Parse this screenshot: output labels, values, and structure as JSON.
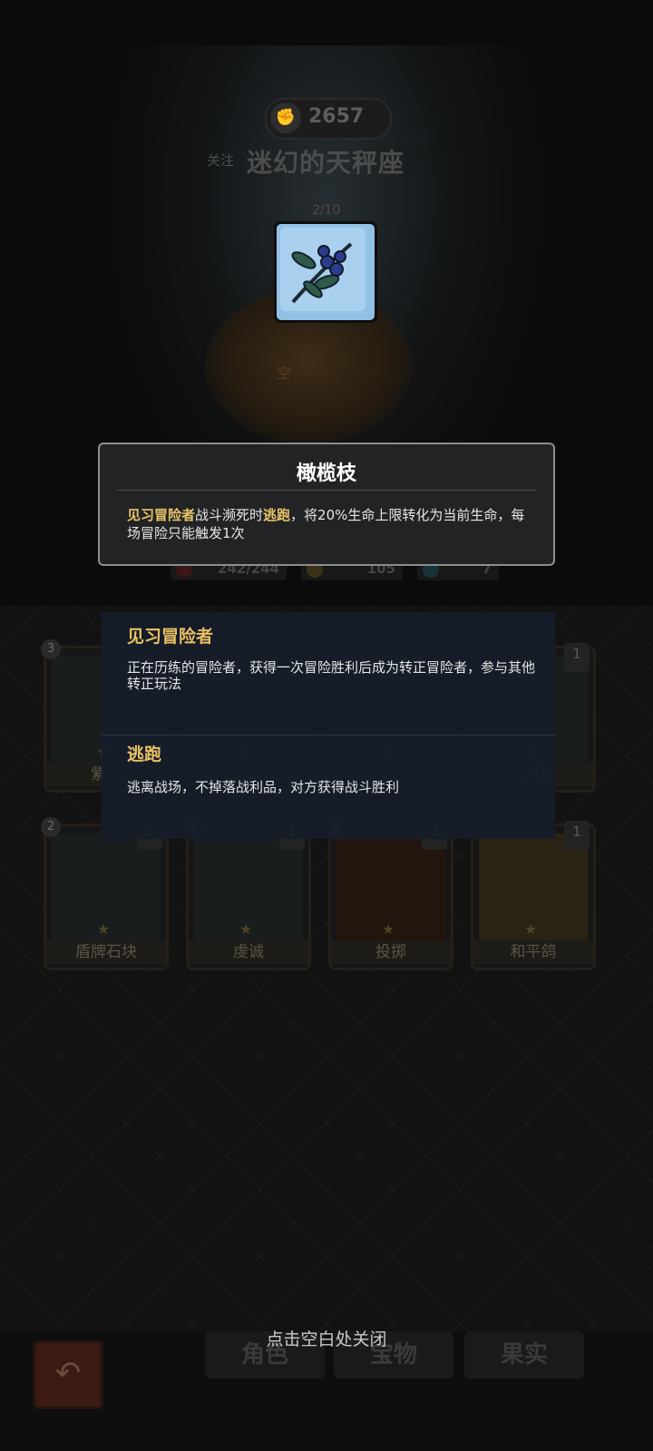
{
  "opponent": {
    "score": "2657",
    "follow_label": "关注",
    "name": "迷幻的天秤座",
    "counter": "2/10",
    "hero_tag": "空"
  },
  "stats": {
    "hp": "242/244",
    "attack": "105",
    "third": "7"
  },
  "tooltip": {
    "title": "橄榄枝",
    "desc_kw1": "见习冒险者",
    "desc_mid1": "战斗濒死时",
    "desc_kw2": "逃跑",
    "desc_rest": "，将20%生命上限转化为当前生命，每场冒险只能触发1次"
  },
  "keywords": [
    {
      "title": "见习冒险者",
      "text": "正在历练的冒险者，获得一次冒险胜利后成为转正冒险者，参与其他转正玩法"
    },
    {
      "title": "逃跑",
      "text": "逃离战场，不掉落战利品，对方获得战斗胜利"
    }
  ],
  "cards_row1": [
    {
      "name": "紫…",
      "level": "3",
      "stack": ""
    },
    {
      "name": "…",
      "level": "",
      "stack": ""
    },
    {
      "name": "…",
      "level": "",
      "stack": ""
    },
    {
      "name": "…灯",
      "level": "",
      "stack": "1"
    }
  ],
  "cards_row2": [
    {
      "name": "盾牌石块",
      "level": "2",
      "stack": "2"
    },
    {
      "name": "虔诚",
      "level": "2",
      "stack": "1"
    },
    {
      "name": "投掷",
      "level": "2",
      "stack": "2"
    },
    {
      "name": "和平鸽",
      "level": "",
      "stack": "1"
    }
  ],
  "nav": {
    "tab1": "角色",
    "tab2": "宝物",
    "tab3": "果实",
    "close_hint": "点击空白处关闭"
  }
}
